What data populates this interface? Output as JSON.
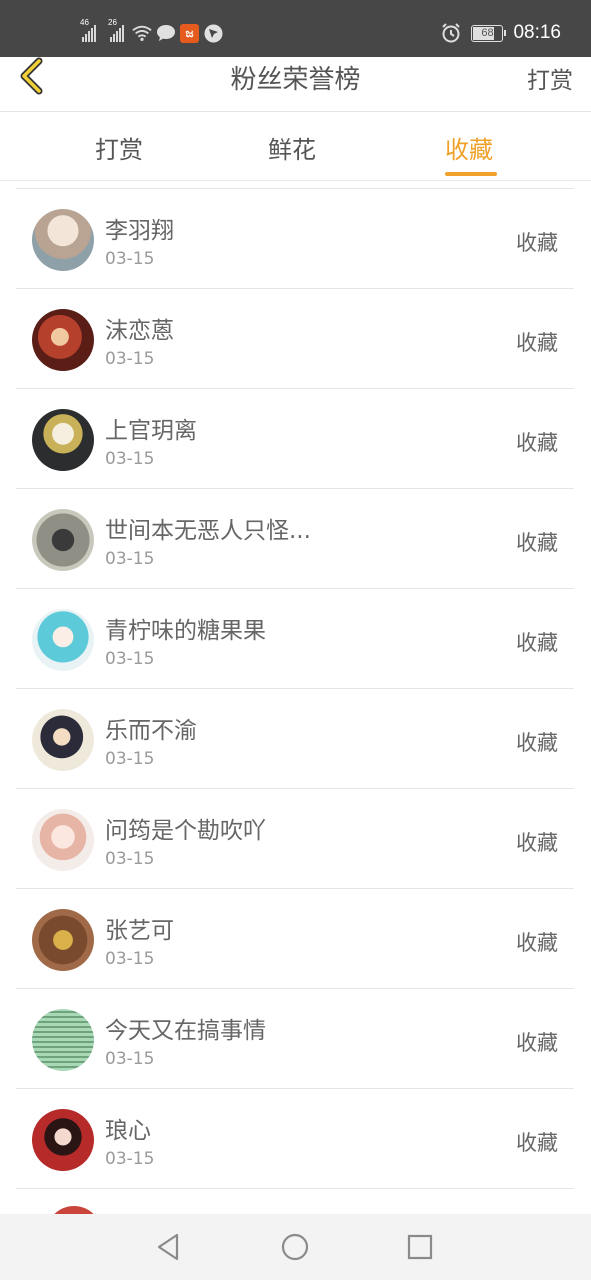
{
  "status_bar": {
    "signal1_label": "46",
    "signal2_label": "26",
    "app_badge": "ಜ",
    "battery": "68",
    "time": "08:16"
  },
  "header": {
    "title": "粉丝荣誉榜",
    "action": "打赏"
  },
  "tabs": [
    {
      "label": "打赏",
      "active": false
    },
    {
      "label": "鲜花",
      "active": false
    },
    {
      "label": "收藏",
      "active": true
    }
  ],
  "accent_color": "#f0a12a",
  "fans": [
    {
      "name": "李羽翔",
      "date": "03-15",
      "action": "收藏",
      "avatar": "portrait-girl-light"
    },
    {
      "name": "沫恋蒽",
      "date": "03-15",
      "action": "收藏",
      "avatar": "portrait-red"
    },
    {
      "name": "上官玥离",
      "date": "03-15",
      "action": "收藏",
      "avatar": "anime-ornate"
    },
    {
      "name": "世间本无恶人只怪...",
      "date": "03-15",
      "action": "收藏",
      "avatar": "portrait-dark-figure"
    },
    {
      "name": "青柠味的糖果果",
      "date": "03-15",
      "action": "收藏",
      "avatar": "anime-blue-hair"
    },
    {
      "name": "乐而不渝",
      "date": "03-15",
      "action": "收藏",
      "avatar": "portrait-dark-hair"
    },
    {
      "name": "问筠是个勘吹吖",
      "date": "03-15",
      "action": "收藏",
      "avatar": "anime-pink"
    },
    {
      "name": "张艺可",
      "date": "03-15",
      "action": "收藏",
      "avatar": "portrait-brown"
    },
    {
      "name": "今天又在搞事情",
      "date": "03-15",
      "action": "收藏",
      "avatar": "text-pattern-green"
    },
    {
      "name": "琅心",
      "date": "03-15",
      "action": "收藏",
      "avatar": "portrait-red-robe"
    }
  ]
}
